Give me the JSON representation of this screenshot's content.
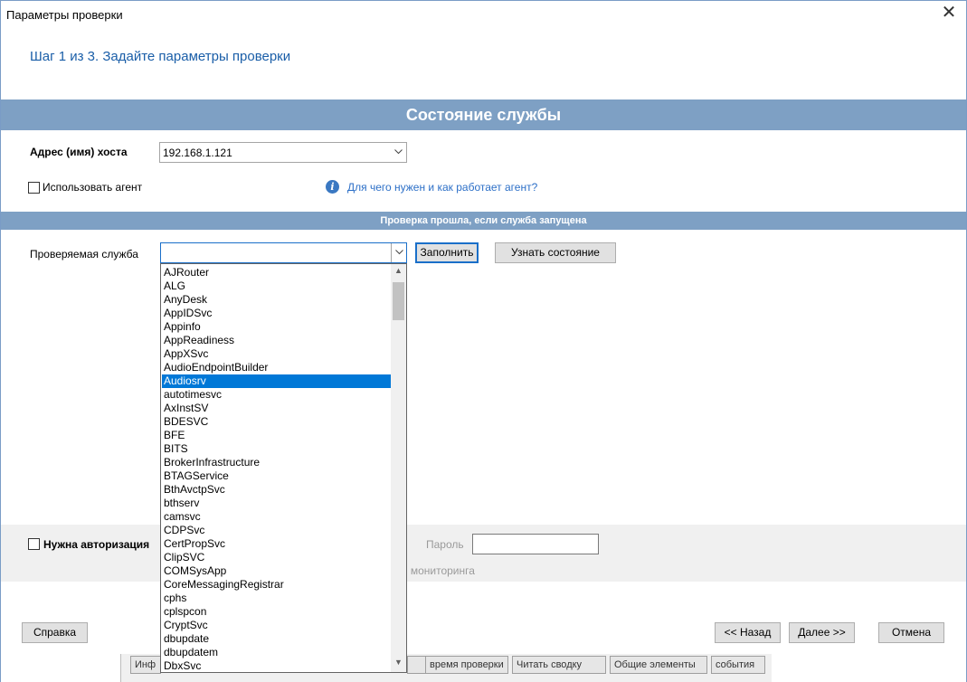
{
  "window": {
    "title": "Параметры проверки",
    "close_glyph": "✕"
  },
  "step_text": "Шаг 1 из 3. Задайте параметры проверки",
  "section_title": "Состояние службы",
  "host": {
    "label": "Адрес (имя) хоста",
    "value": "192.168.1.121"
  },
  "agent": {
    "checkbox_label": "Использовать агент",
    "checked": false,
    "info_link": "Для чего нужен и как работает агент?"
  },
  "check_condition": "Проверка прошла, если служба запущена",
  "service": {
    "label": "Проверяемая служба",
    "value": "",
    "fill_button": "Заполнить",
    "status_button": "Узнать состояние",
    "dropdown_items": [
      "AJRouter",
      "ALG",
      "AnyDesk",
      "AppIDSvc",
      "Appinfo",
      "AppReadiness",
      "AppXSvc",
      "AudioEndpointBuilder",
      "Audiosrv",
      "autotimesvc",
      "AxInstSV",
      "BDESVC",
      "BFE",
      "BITS",
      "BrokerInfrastructure",
      "BTAGService",
      "BthAvctpSvc",
      "bthserv",
      "camsvc",
      "CDPSvc",
      "CertPropSvc",
      "ClipSVC",
      "COMSysApp",
      "CoreMessagingRegistrar",
      "cphs",
      "cplspcon",
      "CryptSvc",
      "dbupdate",
      "dbupdatem",
      "DbxSvc"
    ],
    "selected_item": "Audiosrv"
  },
  "auth": {
    "checkbox_label": "Нужна авторизация",
    "checked": false,
    "password_label": "Пароль",
    "password_value": "",
    "hint_fragment": "я мониторинга"
  },
  "footer": {
    "help": "Справка",
    "back": "<< Назад",
    "next": "Далее >>",
    "cancel": "Отмена"
  },
  "background_tabs": [
    "Инф",
    "",
    "время проверки",
    "Читать сводку",
    "Общие элементы",
    "события"
  ],
  "colors": {
    "band": "#7ea0c4",
    "accent": "#1a6fc9",
    "selection": "#0078d7",
    "link": "#2c6fc7"
  }
}
